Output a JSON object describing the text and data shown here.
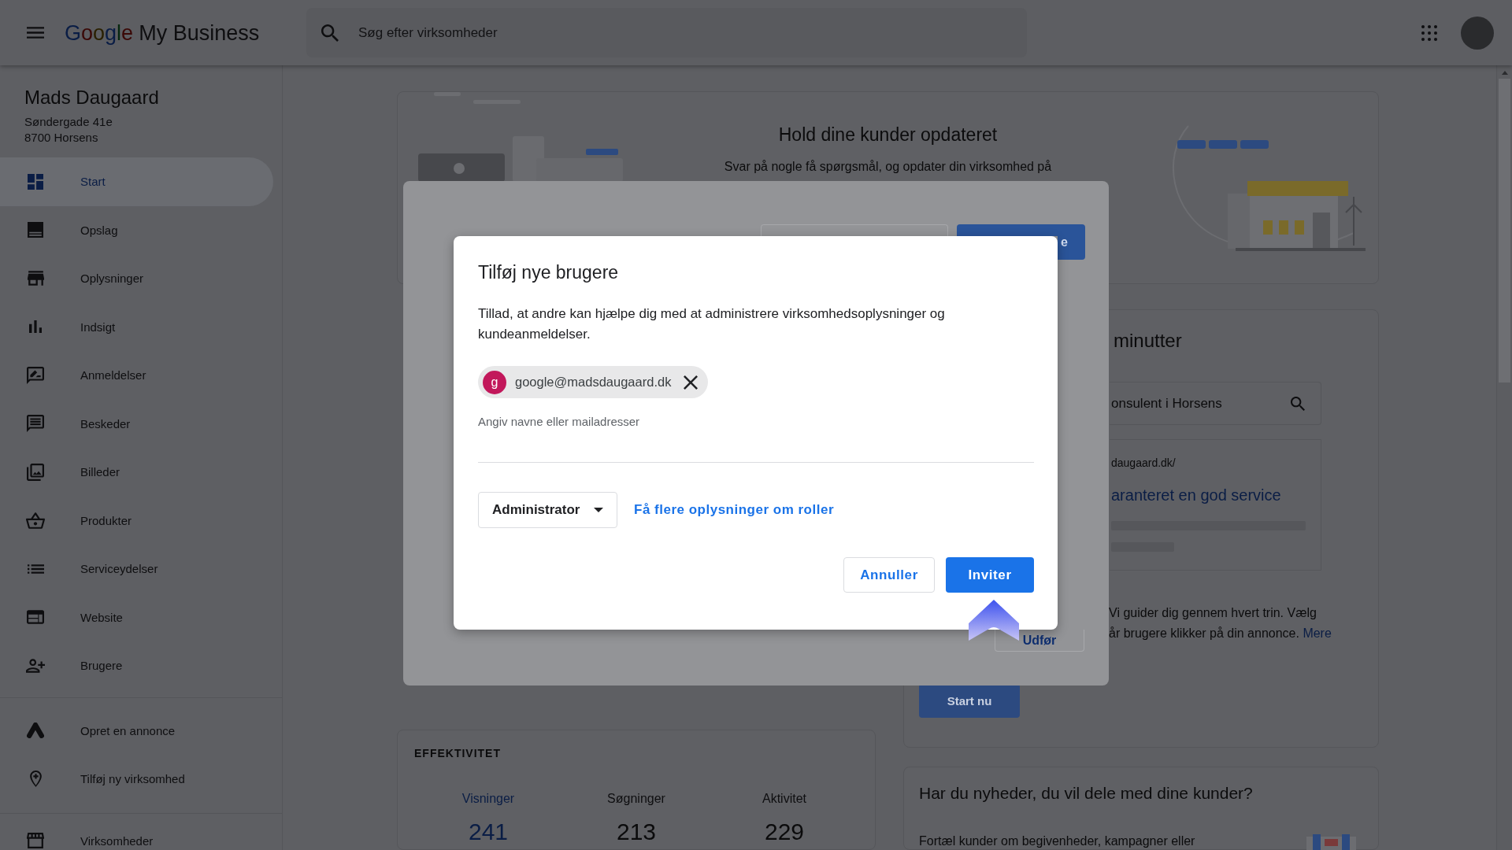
{
  "top_bar": {
    "logo": "Google",
    "product": "My Business",
    "search": {
      "placeholder": "Søg efter virksomheder"
    }
  },
  "sidebar": {
    "business_name": "Mads Daugaard",
    "address": [
      "Søndergade 41e",
      "8700 Horsens"
    ],
    "sections": [
      {
        "items": [
          {
            "label": "Start",
            "selected": true
          },
          {
            "label": "Opslag",
            "selected": false
          },
          {
            "label": "Oplysninger",
            "selected": false
          },
          {
            "label": "Indsigt",
            "selected": false
          },
          {
            "label": "Anmeldelser",
            "selected": false
          },
          {
            "label": "Beskeder",
            "selected": false
          },
          {
            "label": "Billeder",
            "selected": false
          },
          {
            "label": "Produkter",
            "selected": false
          },
          {
            "label": "Serviceydelser",
            "selected": false
          },
          {
            "label": "Website",
            "selected": false
          },
          {
            "label": "Brugere",
            "selected": false
          }
        ]
      },
      {
        "items": [
          {
            "label": "Opret en annonce",
            "selected": false
          },
          {
            "label": "Tilføj ny virksomhed",
            "selected": false
          }
        ]
      },
      {
        "items": [
          {
            "label": "Virksomheder",
            "selected": false
          }
        ]
      }
    ]
  },
  "update_card": {
    "title": "Hold dine kunder opdateret",
    "text": "Svar på nogle få spørgsmål, og opdater din virksomhed på"
  },
  "ad_card": {
    "title": "minutter",
    "search_value": "onsulent i Horsens",
    "preview": {
      "url": "daugaard.dk/",
      "headline": "aranteret en god service"
    },
    "lines": [
      "Vi guider dig gennem hvert trin. Vælg",
      "år brugere klikker på din annonce."
    ],
    "more_link": "Mere",
    "start_button": "Start nu"
  },
  "performance_card": {
    "title": "EFFEKTIVITET",
    "metrics": [
      {
        "label": "Visninger",
        "value": "241",
        "selected": true
      },
      {
        "label": "Søgninger",
        "value": "213",
        "selected": false
      },
      {
        "label": "Aktivitet",
        "value": "229",
        "selected": false
      }
    ]
  },
  "news_card": {
    "title": "Har du nyheder, du vil dele med dine kunder?",
    "text": "Fortæl kunder om begivenheder, kampagner eller"
  },
  "background_dialog": {
    "primary_button": "e",
    "action_button": "Udfør"
  },
  "dialog": {
    "title": "Tilføj nye brugere",
    "description": "Tillad, at andre kan hjælpe dig med at administrere virksomhedsoplysninger og kundeanmeldelser.",
    "recipients": [
      {
        "initial": "g",
        "email": "google@madsdaugaard.dk"
      }
    ],
    "placeholder": "Angiv navne eller mailadresser",
    "role": "Administrator",
    "roles_link": "Få flere oplysninger om roller",
    "buttons": [
      {
        "label": "Annuller",
        "kind": "outlined"
      },
      {
        "label": "Inviter",
        "kind": "filled"
      }
    ]
  }
}
